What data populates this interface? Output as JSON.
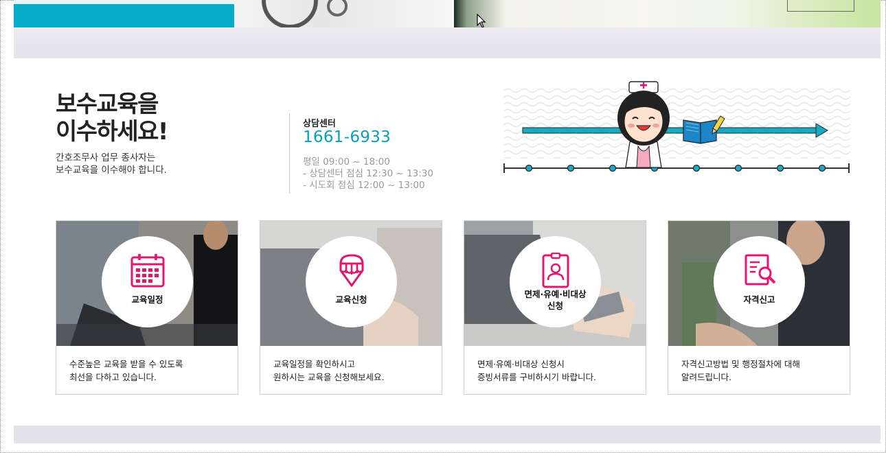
{
  "intro": {
    "title_line1": "보수교육을",
    "title_line2": "이수하세요!",
    "desc_line1": "간호조무사 업무 종사자는",
    "desc_line2": "보수교육을 이수해야 합니다."
  },
  "contact": {
    "label": "상담센터",
    "phone": "1661-6933",
    "hours_line1": "평일 09:00 ~ 18:00",
    "hours_line2": "- 상담센터 점심 12:30 ~ 13:30",
    "hours_line3": "- 시도회 점심 12:00 ~ 13:00"
  },
  "cards": [
    {
      "label_line1": "교육일정",
      "label_line2": "",
      "icon": "calendar-icon",
      "desc_line1": "수준높은 교육을 받을 수 있도록",
      "desc_line2": "최선을 다하고 있습니다."
    },
    {
      "label_line1": "교육신청",
      "label_line2": "",
      "icon": "pencil-icon",
      "desc_line1": "교육일정을 확인하시고",
      "desc_line2": "원하시는 교육을 신청해보세요."
    },
    {
      "label_line1": "면제·유예·비대상",
      "label_line2": "신청",
      "icon": "id-badge-icon",
      "desc_line1": "면제·유예·비대상 신청시",
      "desc_line2": "증빙서류를 구비하시기 바랍니다."
    },
    {
      "label_line1": "자격신고",
      "label_line2": "",
      "icon": "document-search-icon",
      "desc_line1": "자격신고방법 및 행정절차에 대해",
      "desc_line2": "알려드립니다."
    }
  ],
  "colors": {
    "accent_teal": "#06aec9",
    "phone": "#0a9ebd",
    "icon_pink": "#e6146e",
    "timeline": "#1aa9c4"
  }
}
